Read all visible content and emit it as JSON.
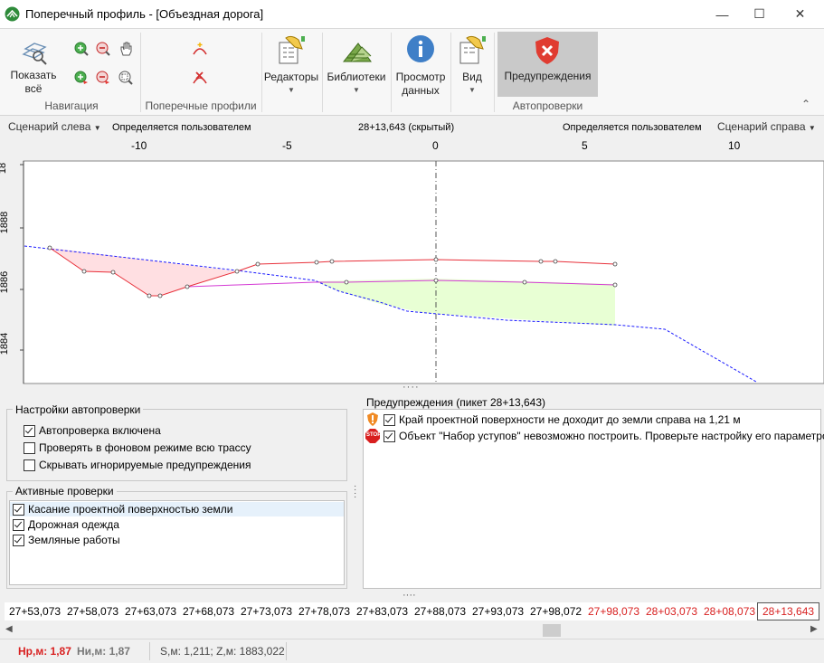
{
  "window": {
    "title": "Поперечный профиль - [Объездная дорога]",
    "minimize": "—",
    "maximize": "☐",
    "close": "✕"
  },
  "ribbon": {
    "show_all_label": "Показать всё",
    "nav_group": "Навигация",
    "cross_group": "Поперечные профили",
    "editors": "Редакторы",
    "libraries": "Библиотеки",
    "view_data": "Просмотр данных",
    "view": "Вид",
    "warnings": "Предупреждения",
    "auto_group": "Автопроверки",
    "collapse": "⌃"
  },
  "scenario": {
    "left": "Сценарий слева",
    "left_mode": "Определяется пользователем",
    "center": "28+13,643 (скрытый)",
    "right_mode": "Определяется пользователем",
    "right": "Сценарий справа",
    "ticks": [
      "-10",
      "-5",
      "0",
      "5",
      "10"
    ]
  },
  "plot": {
    "y_ticks": [
      "18",
      "1888",
      "1886",
      "1884"
    ]
  },
  "autocheck": {
    "title": "Настройки автопроверки",
    "enabled": "Автопроверка включена",
    "background": "Проверять в фоновом режиме всю трассу",
    "hide_ignored": "Скрывать игнорируемые предупреждения"
  },
  "active_checks": {
    "title": "Активные проверки",
    "items": [
      "Касание проектной поверхностью земли",
      "Дорожная одежда",
      "Земляные работы"
    ]
  },
  "warnings_panel": {
    "title": "Предупреждения (пикет 28+13,643)",
    "items": [
      "Край проектной поверхности не доходит до земли справа на 1,21 м",
      "Объект \"Набор уступов\" невозможно построить. Проверьте настройку его параметров"
    ],
    "stop_text": "STOP"
  },
  "pickets": [
    "27+53,073",
    "27+58,073",
    "27+63,073",
    "27+68,073",
    "27+73,073",
    "27+78,073",
    "27+83,073",
    "27+88,073",
    "27+93,073",
    "27+98,072",
    "27+98,073",
    "28+03,073",
    "28+08,073",
    "28+13,643"
  ],
  "status": {
    "hr": "Нр,м: 1,87",
    "hi": "Ни,м: 1,87",
    "coords": "S,м: 1,211;  Z,м: 1883,022"
  },
  "colors": {
    "accent_red": "#d81f1f",
    "design_line": "#e8303a",
    "fill_cut": "#ffd9dc",
    "fill_fill": "#e6ffd0",
    "ground": "#1a1aff",
    "subgrade": "#d43bd4"
  }
}
